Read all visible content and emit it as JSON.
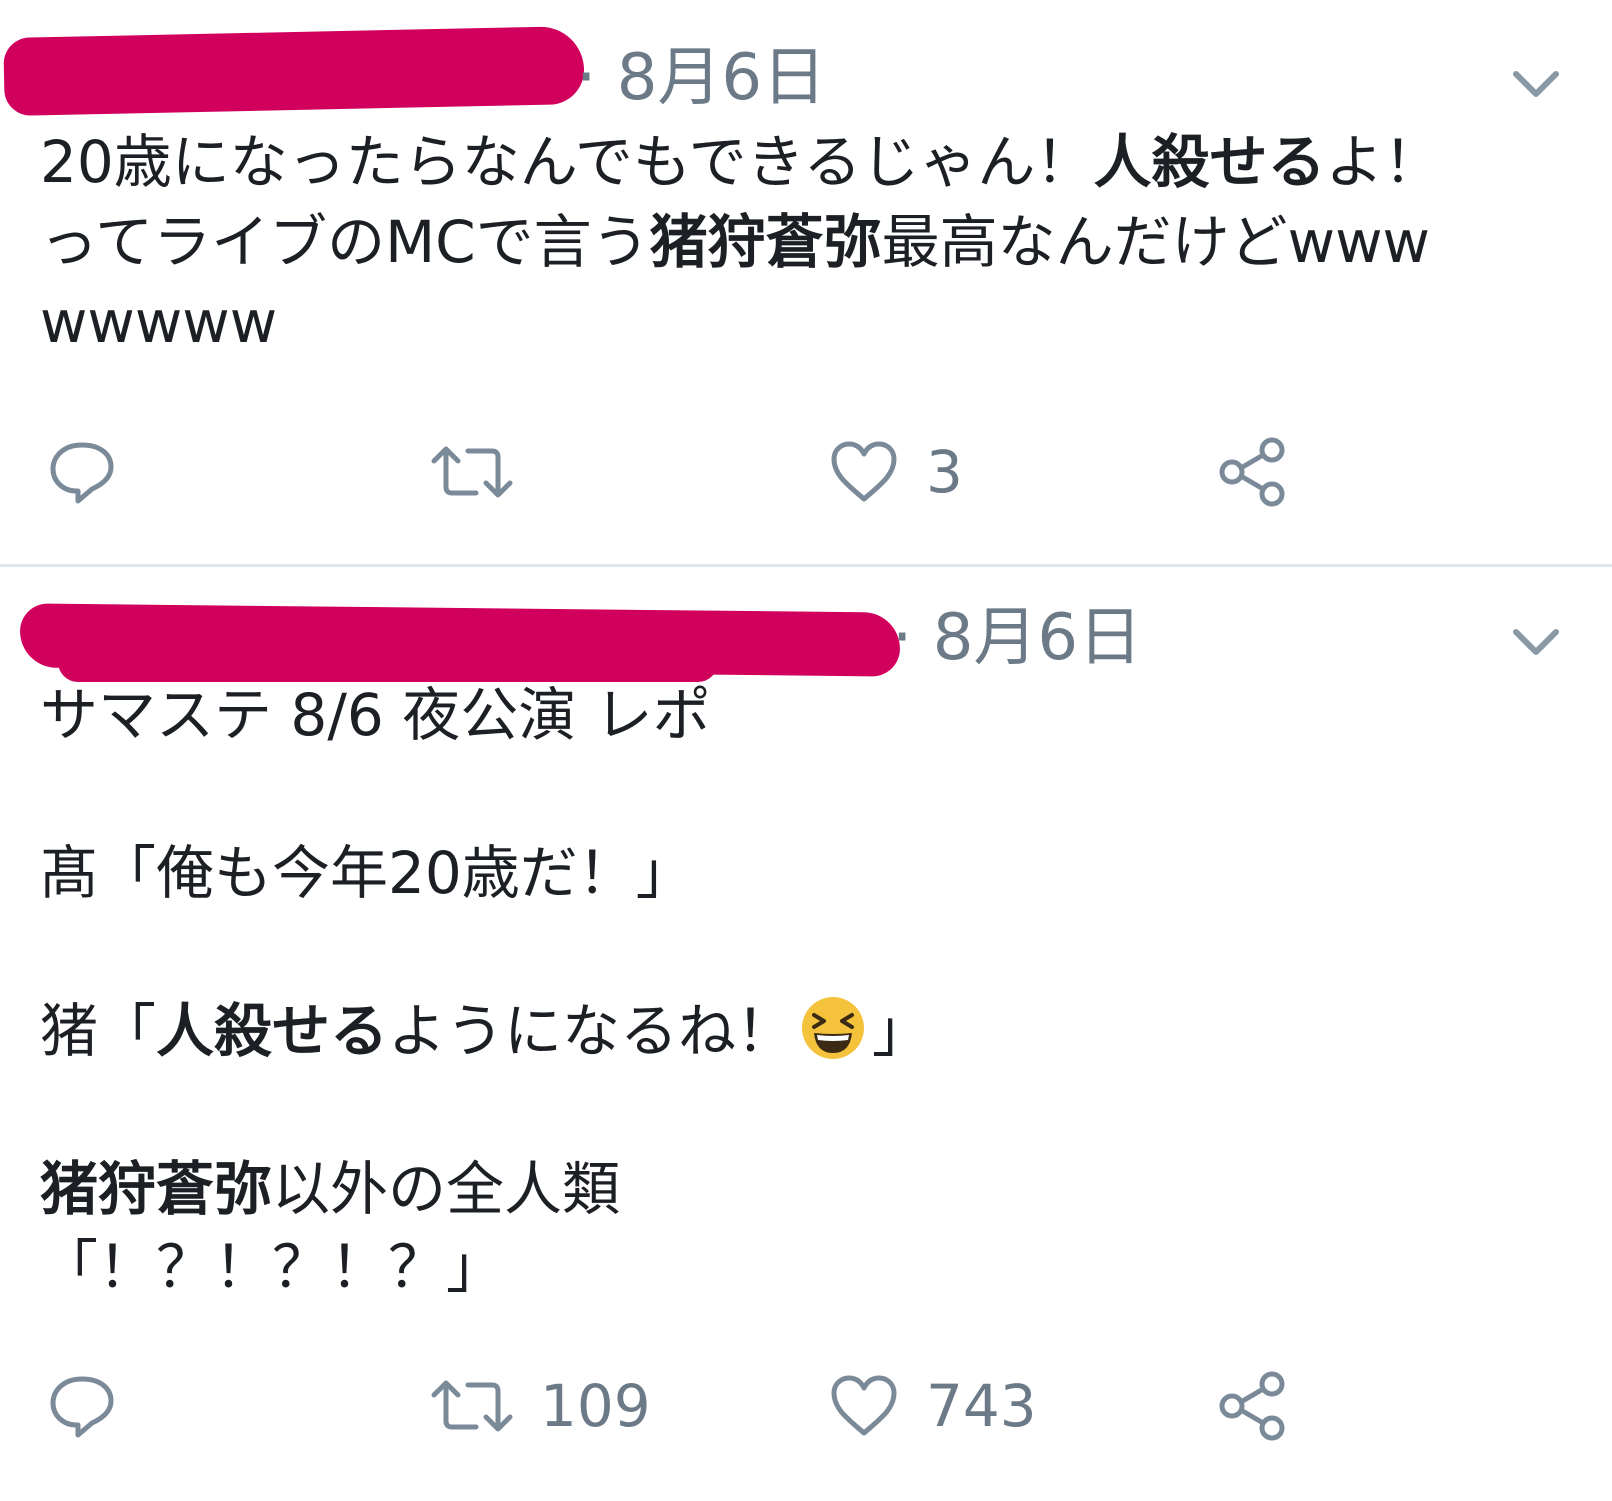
{
  "tweets": [
    {
      "timestamp": "· 8月6日",
      "lines": [
        [
          "20歳になったらなんでもできるじゃん！",
          {
            "bold": "人殺せる"
          },
          "よ！"
        ],
        [
          "ってライブのMCで言う",
          {
            "bold": "猪狩蒼弥"
          },
          "最高なんだけどwww"
        ],
        [
          "wwwww"
        ]
      ],
      "actions": {
        "reply_count": "",
        "retweet_count": "",
        "like_count": "3"
      }
    },
    {
      "timestamp": "· 8月6日",
      "lines": [
        [
          "サマステ 8/6 夜公演 レポ"
        ],
        [],
        [
          "髙「俺も今年20歳だ！」"
        ],
        [],
        [
          "猪「",
          {
            "bold": "人殺せる"
          },
          "ようになるね！",
          {
            "emoji": "grinning-squinting-face"
          },
          "」"
        ],
        [],
        [
          {
            "bold": "猪狩蒼弥"
          },
          "以外の全人類"
        ],
        [
          "「！？！？！？」"
        ]
      ],
      "actions": {
        "reply_count": "",
        "retweet_count": "109",
        "like_count": "743"
      }
    }
  ],
  "colors": {
    "redaction": "#d0005c",
    "meta_gray": "#6c7a88",
    "icon_gray": "#7b8a98",
    "divider": "#e1e8ed",
    "text": "#1c1f23"
  },
  "icons": {
    "reply": "speech-bubble-icon",
    "retweet": "retweet-arrows-icon",
    "like": "heart-icon",
    "share": "share-nodes-icon",
    "menu": "chevron-down-icon"
  }
}
